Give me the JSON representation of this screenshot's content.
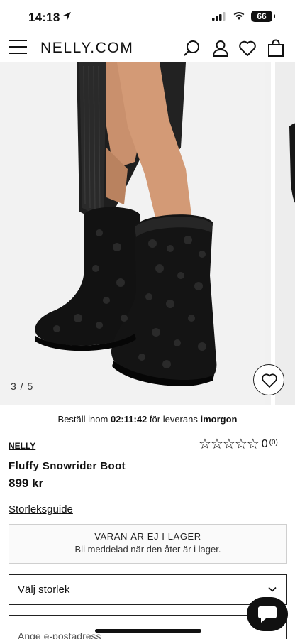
{
  "status_bar": {
    "time": "14:18",
    "battery": "66"
  },
  "header": {
    "logo": "NELLY.COM",
    "icons": [
      "menu-icon",
      "search-icon",
      "user-icon",
      "heart-icon",
      "bag-icon"
    ]
  },
  "gallery": {
    "counter": "3 / 5"
  },
  "delivery": {
    "prefix": "Beställ inom",
    "countdown": "02:11:42",
    "middle": "för leverans",
    "day": "imorgon"
  },
  "product": {
    "brand": "NELLY",
    "name": "Fluffy Snowrider Boot",
    "price": "899 kr",
    "rating_value": "0",
    "rating_count": "(0)",
    "stars_filled": 0,
    "stars_total": 5
  },
  "size_guide": "Storleksguide",
  "stock": {
    "title": "VARAN ÄR EJ I LAGER",
    "subtitle": "Bli meddelad när den åter är i lager."
  },
  "size_select": {
    "label": "Välj storlek"
  },
  "email": {
    "placeholder": "Ange e-postadress"
  },
  "colors": {
    "text": "#111111",
    "accent": "#000000"
  }
}
